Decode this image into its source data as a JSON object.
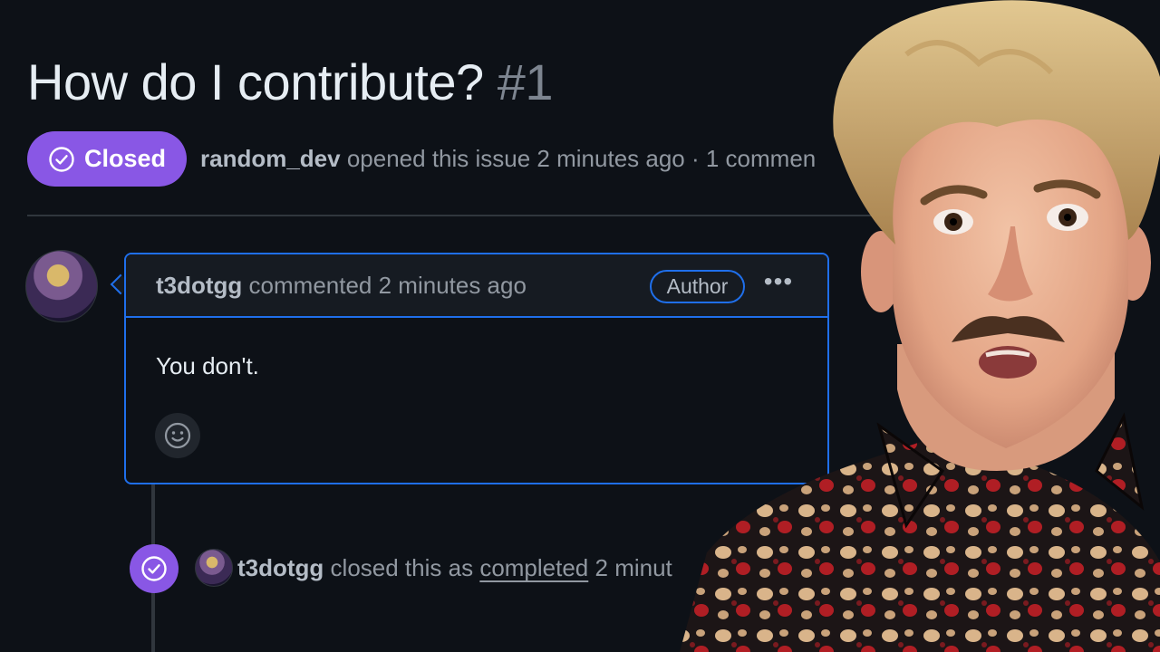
{
  "issue": {
    "title": "How do I contribute?",
    "number": "#1",
    "state": "Closed",
    "author": "random_dev",
    "meta_text": "opened this issue 2 minutes ago · 1 commen"
  },
  "comment": {
    "user": "t3dotgg",
    "action": "commented 2 minutes ago",
    "badge": "Author",
    "body": "You don't.",
    "menu_icon": "kebab-horizontal-icon",
    "reaction_icon": "smiley-icon"
  },
  "event": {
    "user": "t3dotgg",
    "text_before": "closed this as",
    "link": "completed",
    "text_after": "2 minut"
  },
  "colors": {
    "background": "#0d1117",
    "closed_purple": "#8957e5",
    "focus_blue": "#1f6feb",
    "muted_text": "#9198a1"
  }
}
